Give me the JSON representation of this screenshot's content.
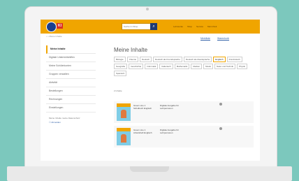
{
  "header": {
    "logo_text": "Kl",
    "search_placeholder": "Suche im Shop",
    "nav": [
      "Lehrwerke",
      "Shop",
      "Service",
      "Mein Klett"
    ]
  },
  "breadcrumb": "Meine Inhalte",
  "utility": {
    "merkliste": "Merkliste",
    "warenkorb": "Warenkorb"
  },
  "sidebar": {
    "items": [
      "Meine Inhalte",
      "Digitale Unterrichtshilfen",
      "Meine Schülerkonten",
      "Gruppen verwalten",
      "Aktivität",
      "Bestellungen",
      "Rechnungen",
      "Einstellungen"
    ],
    "note": "Meine Inhalte meine Datenschutz",
    "link": "Abmelden"
  },
  "main": {
    "title": "Meine Inhalte",
    "filters": [
      "Biologie",
      "Chemie",
      "Deutsch",
      "Deutsch als Fremdsprache",
      "Deutsch als Zweitsprache",
      "Englisch",
      "Französisch",
      "Geografie",
      "Geschichte",
      "Informatik",
      "Italienisch",
      "Mathematik",
      "Medien",
      "Musik",
      "Natur und Technik",
      "Physik",
      "Spanisch"
    ],
    "selected_filter_index": 5,
    "results_label": "2 Inhalte"
  },
  "cards": [
    {
      "title": "Green Line 1 Schulbuch Englisch",
      "desc": "Digitale Ausgabe für Lehrpersonen"
    },
    {
      "title": "Green Line 1 Arbeitsheft Englisch",
      "desc": "Digitale Ausgabe für Lehrpersonen"
    }
  ],
  "colors": {
    "brand": "#f0a500",
    "navy": "#1f3a72",
    "background": "#7cc8bd"
  }
}
